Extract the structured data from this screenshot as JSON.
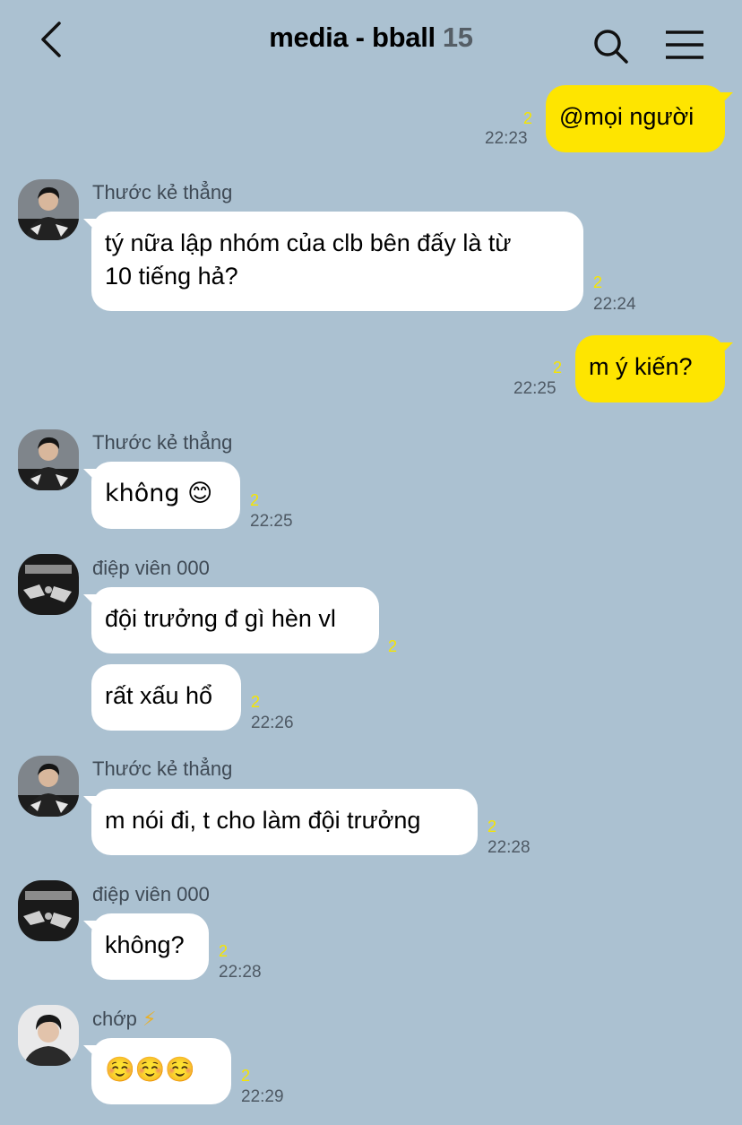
{
  "header": {
    "back_icon": "chevron-left-icon",
    "title": "media - bball",
    "member_count": "15",
    "search_icon": "search-icon",
    "menu_icon": "hamburger-menu-icon"
  },
  "colors": {
    "background": "#abc1d1",
    "my_bubble": "#fee500",
    "their_bubble": "#ffffff",
    "unread_count": "#f6e500"
  },
  "messages": [
    {
      "direction": "out",
      "text": "@mọi người",
      "unread": "2",
      "time": "22:23"
    },
    {
      "direction": "in",
      "sender": "Thước kẻ thẳng",
      "avatar": "avatar-photo",
      "text_line1": "tý nữa lập nhóm của clb bên đấy là từ",
      "text_line2": "10 tiếng hả?",
      "unread": "2",
      "time": "22:24"
    },
    {
      "direction": "out",
      "text": "m ý kiến?",
      "unread": "2",
      "time": "22:25"
    },
    {
      "direction": "in",
      "sender": "Thước kẻ thẳng",
      "avatar": "avatar-photo",
      "text": "không 😊",
      "unread": "2",
      "time": "22:25"
    },
    {
      "direction": "in",
      "sender": "điệp viên 000",
      "avatar": "avatar-photo",
      "text": "đội trưởng đ gì hèn vl",
      "unread": "2"
    },
    {
      "direction": "in",
      "text": "rất xấu hổ",
      "unread": "2",
      "time": "22:26"
    },
    {
      "direction": "in",
      "sender": "Thước kẻ thẳng",
      "avatar": "avatar-photo",
      "text": "m nói đi, t cho làm đội trưởng",
      "unread": "2",
      "time": "22:28"
    },
    {
      "direction": "in",
      "sender": "điệp viên 000",
      "avatar": "avatar-photo",
      "text": "không?",
      "unread": "2",
      "time": "22:28"
    },
    {
      "direction": "in",
      "sender": "chớp",
      "sender_icon": "lightning-icon",
      "avatar": "avatar-photo",
      "text": "☺️☺️☺️",
      "unread": "2",
      "time": "22:29"
    }
  ]
}
